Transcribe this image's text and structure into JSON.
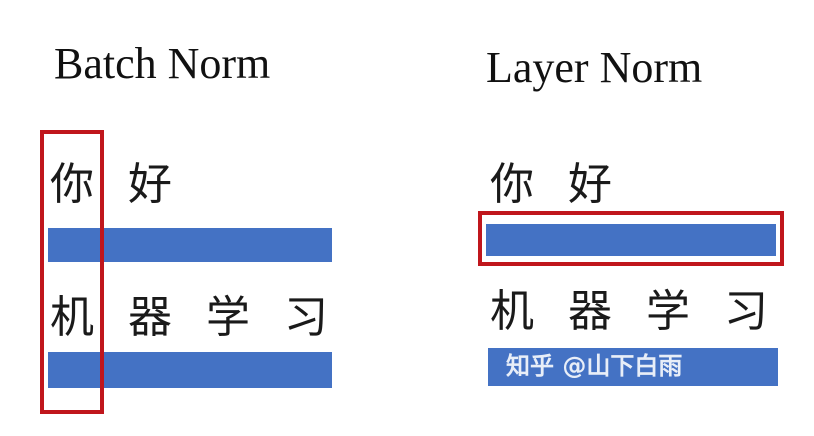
{
  "batch_norm": {
    "title": "Batch Norm",
    "row1": [
      "你",
      "好"
    ],
    "row2": [
      "机",
      "器",
      "学",
      "习"
    ]
  },
  "layer_norm": {
    "title": "Layer Norm",
    "row1": [
      "你",
      "好"
    ],
    "row2": [
      "机",
      "器",
      "学",
      "习"
    ]
  },
  "watermark": "知乎 @山下白雨",
  "colors": {
    "bar": "#4472c4",
    "highlight": "#c0161c",
    "text": "#1a1a1a",
    "background": "#ffffff"
  }
}
